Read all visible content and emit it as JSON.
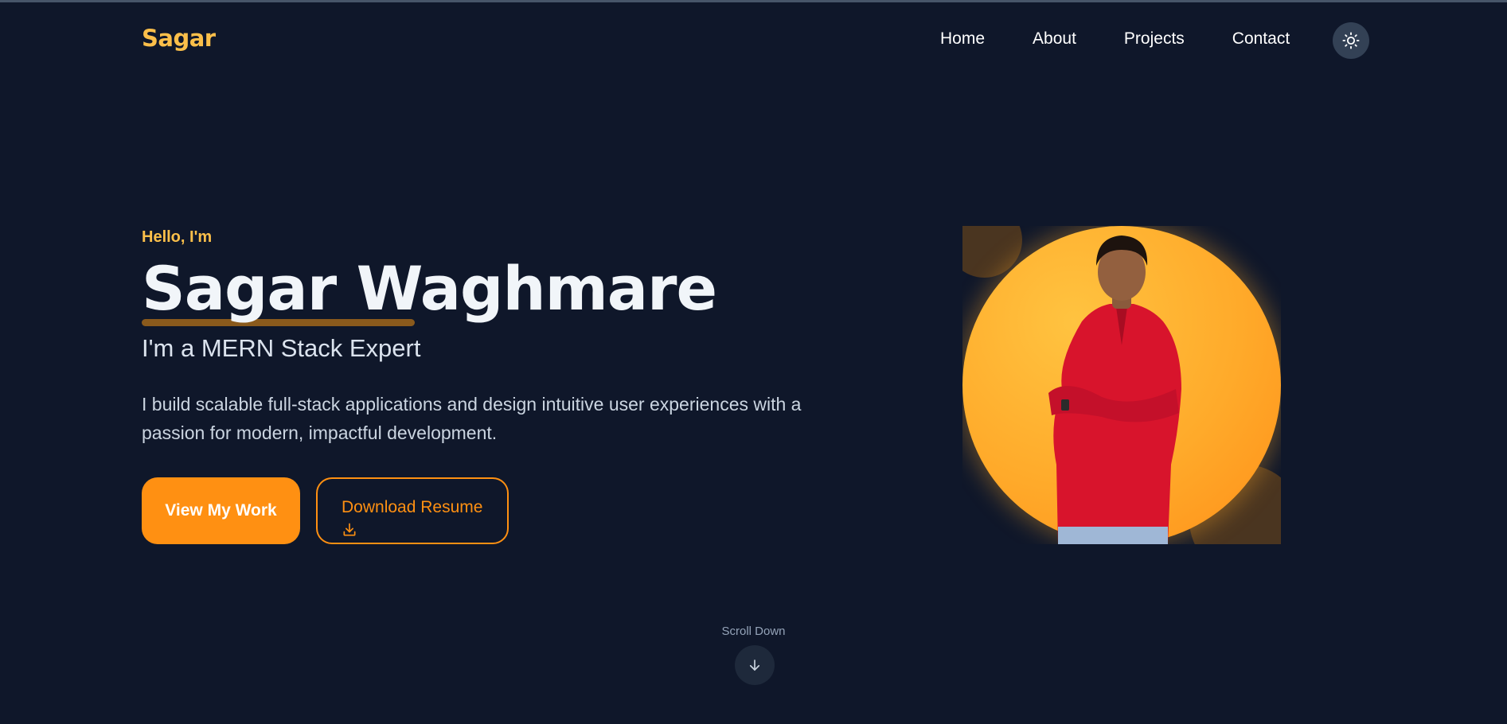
{
  "nav": {
    "logo": "Sagar",
    "links": [
      "Home",
      "About",
      "Projects",
      "Contact"
    ],
    "theme_icon": "sun-icon"
  },
  "hero": {
    "greeting": "Hello, I'm",
    "name": "Sagar Waghmare",
    "role": "I'm a MERN Stack Expert",
    "description": "I build scalable full-stack applications and design intuitive user experiences with a passion for modern, impactful development.",
    "primary_button": "View My Work",
    "secondary_button": "Download Resume",
    "secondary_icon": "download-icon"
  },
  "scroll": {
    "label": "Scroll Down",
    "icon": "arrow-down-icon"
  },
  "colors": {
    "background": "#0f172a",
    "accent": "#ff9012",
    "accent_light": "#fbbf4a",
    "shirt": "#d8142c"
  }
}
